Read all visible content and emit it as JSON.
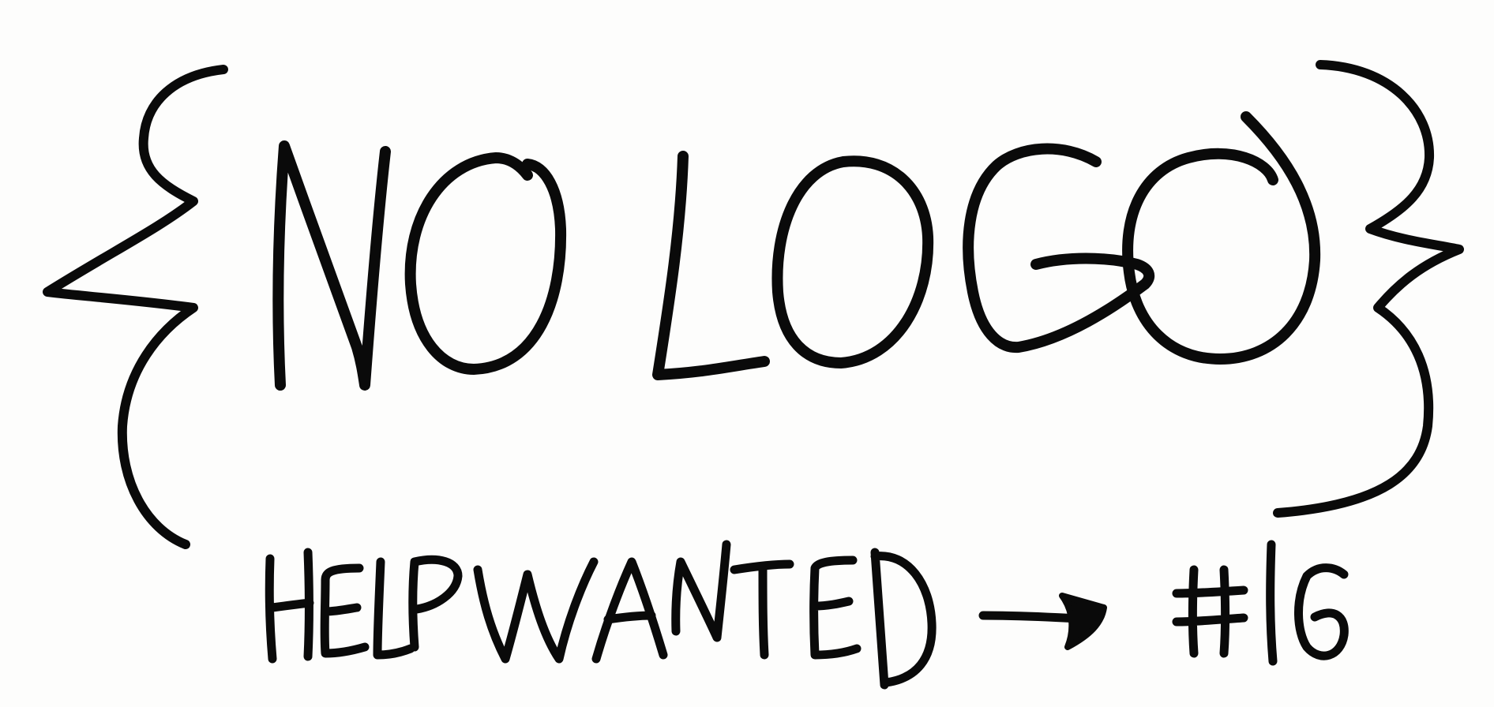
{
  "sign": {
    "title": "NO LOGO",
    "subtitle": "HELP WANTED",
    "issue": "#16"
  },
  "colors": {
    "ink": "#0a0a0a",
    "paper": "#fdfdfc"
  },
  "icons": {
    "arrow": "arrow-right-icon",
    "left_brace": "left-brace-icon",
    "right_brace": "right-brace-icon"
  }
}
